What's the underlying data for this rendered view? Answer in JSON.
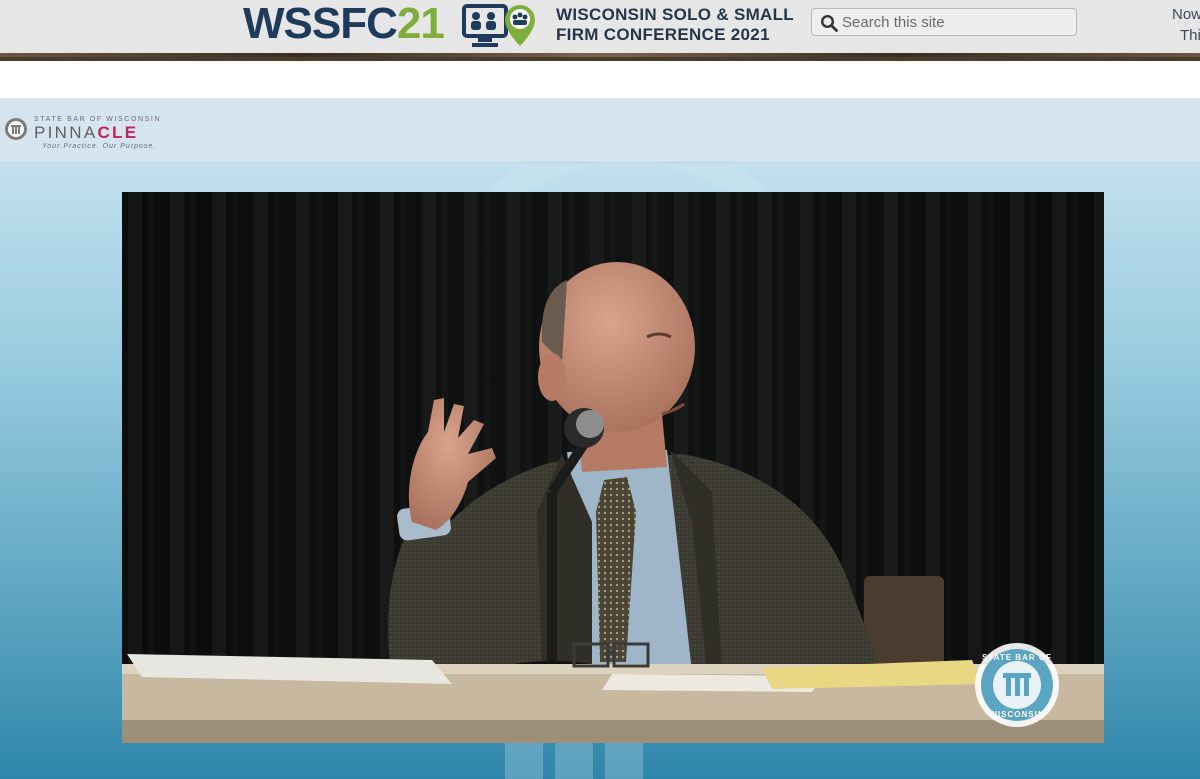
{
  "banner": {
    "logo_main": "WSSFC",
    "logo_year": "21",
    "title_line1": "WISCONSIN SOLO & SMALL",
    "title_line2": "FIRM CONFERENCE 2021",
    "search_placeholder": "Search this site",
    "edge_line1": "Now",
    "edge_line2": "Thi"
  },
  "player": {
    "brand_state": "STATE BAR OF WISCONSIN",
    "brand_name_part1": "PINNA",
    "brand_name_part2": "CLE",
    "brand_tagline": "Your Practice. Our Purpose."
  },
  "video": {
    "watermark_top": "STATE BAR OF",
    "watermark_bottom": "WISCONSIN"
  },
  "colors": {
    "brand_navy": "#1f3b5c",
    "brand_green": "#7fae3f",
    "pinnacle_magenta": "#c0235a",
    "header_bar": "#d6e4f0"
  },
  "icons": [
    "search-icon",
    "conference-logo-icon",
    "state-bar-seal-icon"
  ]
}
